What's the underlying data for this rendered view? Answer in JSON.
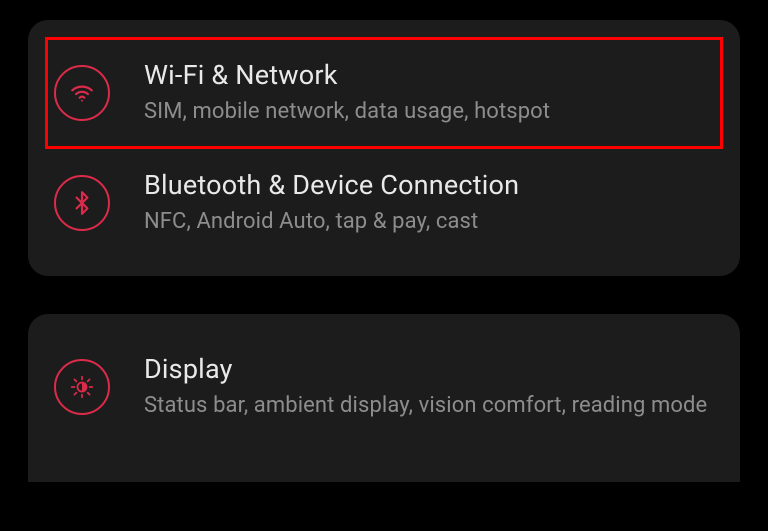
{
  "accent": "#dc2b4a",
  "settings": {
    "groups": [
      {
        "items": [
          {
            "icon": "wifi-icon",
            "title": "Wi-Fi & Network",
            "subtitle": "SIM, mobile network, data usage, hotspot",
            "highlighted": true
          },
          {
            "icon": "bluetooth-icon",
            "title": "Bluetooth & Device Connection",
            "subtitle": "NFC, Android Auto, tap & pay, cast",
            "highlighted": false
          }
        ]
      },
      {
        "items": [
          {
            "icon": "display-icon",
            "title": "Display",
            "subtitle": "Status bar, ambient display, vision comfort, reading mode",
            "highlighted": false
          }
        ]
      }
    ]
  }
}
